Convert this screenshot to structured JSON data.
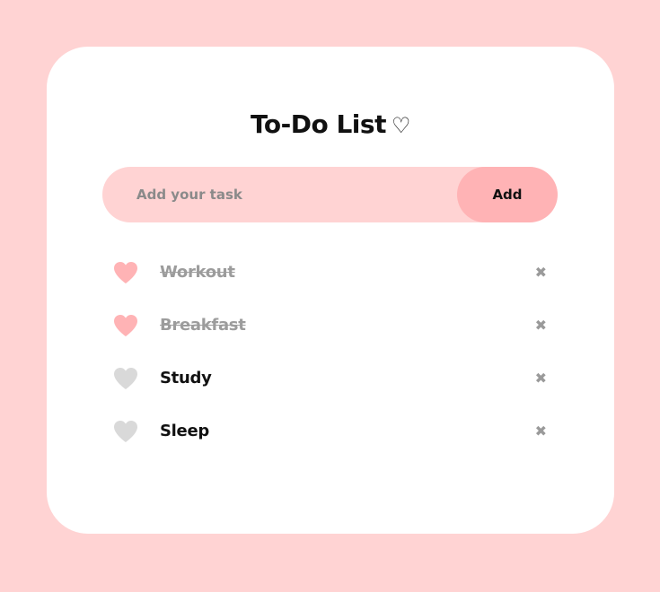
{
  "app": {
    "title": "To-Do List",
    "title_icon": "♡"
  },
  "input": {
    "placeholder": "Add your task",
    "value": ""
  },
  "add_button": {
    "label": "Add"
  },
  "tasks": [
    {
      "label": "Workout",
      "done": true
    },
    {
      "label": "Breakfast",
      "done": true
    },
    {
      "label": "Study",
      "done": false
    },
    {
      "label": "Sleep",
      "done": false
    }
  ],
  "icons": {
    "toggle": "heart-icon",
    "delete": "close-icon",
    "delete_glyph": "✖"
  },
  "colors": {
    "background": "#ffd3d3",
    "card": "#ffffff",
    "input_bg": "#ffd3d3",
    "add_button_bg": "#ffb3b5",
    "heart_done": "#ffb3b5",
    "heart_pending": "#d9d9d9",
    "done_text": "#9c9c9c",
    "text": "#111111"
  }
}
